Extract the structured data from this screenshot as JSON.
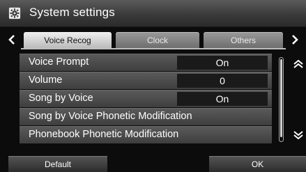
{
  "title": "System settings",
  "title_icon": "gear-icon",
  "tabs": [
    {
      "label": "Voice Recog",
      "active": true
    },
    {
      "label": "Clock",
      "active": false
    },
    {
      "label": "Others",
      "active": false
    }
  ],
  "settings": [
    {
      "label": "Voice Prompt",
      "value": "On"
    },
    {
      "label": "Volume",
      "value": "0"
    },
    {
      "label": "Song by Voice",
      "value": "On"
    },
    {
      "label": "Song by Voice Phonetic Modification"
    },
    {
      "label": "Phonebook Phonetic Modification"
    }
  ],
  "buttons": {
    "default": "Default",
    "ok": "OK"
  },
  "colors": {
    "background": "#0c0c0c",
    "row": "#4a4a4a",
    "active_tab": "#e0e0e0",
    "text": "#ffffff"
  }
}
